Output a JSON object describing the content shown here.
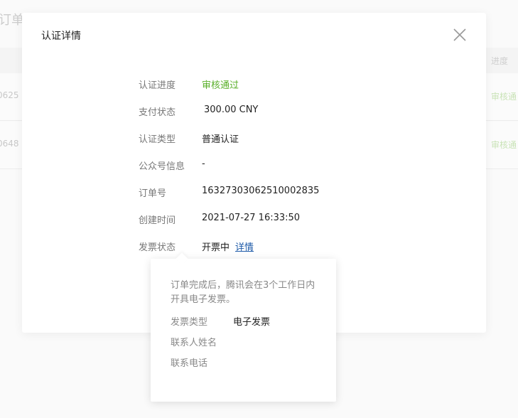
{
  "background": {
    "title_fragment": "订单",
    "header_progress": "进度",
    "rows": [
      {
        "id_fragment": "0625",
        "status_fragment": "审核通"
      },
      {
        "id_fragment": "0648",
        "status_fragment": "审核通"
      }
    ]
  },
  "modal": {
    "title": "认证详情",
    "close_icon": "close-icon",
    "fields": [
      {
        "label": "认证进度",
        "value": "审核通过"
      },
      {
        "label": "支付状态",
        "value": "300.00 CNY"
      },
      {
        "label": "认证类型",
        "value": "普通认证"
      },
      {
        "label": "公众号信息",
        "value": "-"
      },
      {
        "label": "订单号",
        "value": "16327303062510002835"
      },
      {
        "label": "创建时间",
        "value": "2021-07-27 16:33:50"
      },
      {
        "label": "发票状态",
        "value": "开票中",
        "link": "详情"
      }
    ],
    "colors": {
      "success": "#5aaf2a",
      "link": "#1d5aa8"
    }
  },
  "popover": {
    "description": "订单完成后，腾讯会在3个工作日内开具电子发票。",
    "rows": [
      {
        "label": "发票类型",
        "value": "电子发票"
      },
      {
        "label": "联系人姓名",
        "value": ""
      },
      {
        "label": "联系电话",
        "value": ""
      }
    ]
  }
}
